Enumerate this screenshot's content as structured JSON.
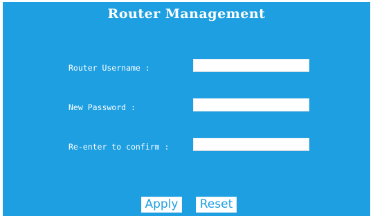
{
  "page": {
    "title": "Router Management"
  },
  "form": {
    "username_label": "Router Username :",
    "username_value": "",
    "password_label": "New Password :",
    "password_value": "",
    "confirm_label": "Re-enter to confirm :",
    "confirm_value": ""
  },
  "buttons": {
    "apply_label": "Apply",
    "reset_label": "Reset"
  },
  "colors": {
    "panel_background": "#1e9fe2",
    "text": "#ffffff",
    "button_text": "#1e9fe2"
  }
}
